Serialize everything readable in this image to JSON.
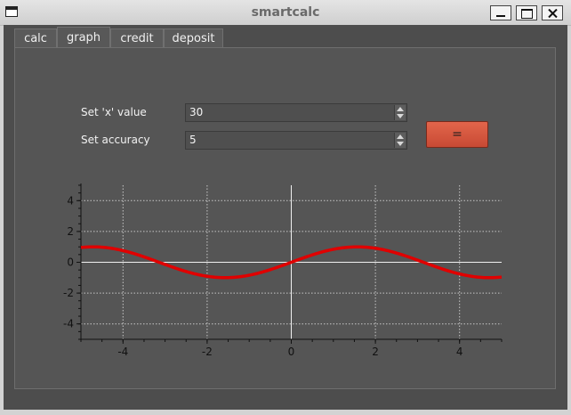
{
  "window": {
    "title": "smartcalc"
  },
  "tabs": [
    {
      "label": "calc"
    },
    {
      "label": "graph"
    },
    {
      "label": "credit"
    },
    {
      "label": "deposit"
    }
  ],
  "graph": {
    "x_label": "Set 'x' value",
    "x_value": "30",
    "accuracy_label": "Set accuracy",
    "accuracy_value": "5",
    "compute_label": "="
  },
  "colors": {
    "curve": "#e00000",
    "button": "#d9573f",
    "panel": "#555555"
  },
  "chart_data": {
    "type": "line",
    "function": "sin(x)",
    "xlim": [
      -5,
      5
    ],
    "ylim": [
      -5,
      5
    ],
    "xticks": [
      -4,
      -2,
      0,
      2,
      4
    ],
    "yticks": [
      -4,
      -2,
      0,
      2,
      4
    ],
    "grid": true,
    "series": [
      {
        "color": "#e00000",
        "x": [
          -5,
          -4.5,
          -4,
          -3.5,
          -3,
          -2.5,
          -2,
          -1.5,
          -1,
          -0.5,
          0,
          0.5,
          1,
          1.5,
          2,
          2.5,
          3,
          3.5,
          4,
          4.5,
          5
        ],
        "y": [
          0.959,
          0.978,
          0.757,
          0.351,
          -0.141,
          -0.598,
          -0.909,
          -0.997,
          -0.841,
          -0.479,
          0,
          0.479,
          0.841,
          0.997,
          0.909,
          0.598,
          0.141,
          -0.351,
          -0.757,
          -0.978,
          -0.959
        ]
      }
    ]
  }
}
